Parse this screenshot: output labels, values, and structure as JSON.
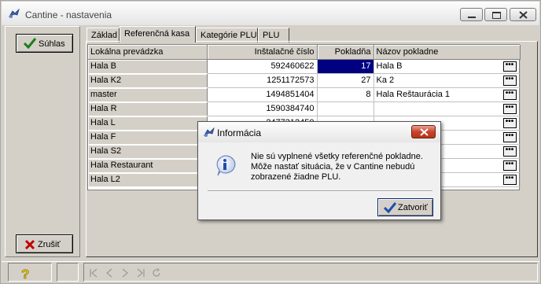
{
  "window": {
    "title": "Cantine - nastavenia"
  },
  "buttons": {
    "ok_label": "Súhlas",
    "cancel_label": "Zrušiť"
  },
  "tabs": [
    {
      "label": "Základ",
      "active": false
    },
    {
      "label": "Referenčná kasa",
      "active": true
    },
    {
      "label": "Kategórie PLU",
      "active": false
    },
    {
      "label": "PLU",
      "active": false
    }
  ],
  "grid": {
    "columns": [
      "Lokálna prevádzka",
      "Inštalačné číslo",
      "Pokladňa",
      "Názov pokladne"
    ],
    "rows": [
      {
        "name": "Hala B",
        "install_no": "592460622",
        "register": "17",
        "register_name": "Hala B"
      },
      {
        "name": "Hala K2",
        "install_no": "1251172573",
        "register": "27",
        "register_name": "Ka 2"
      },
      {
        "name": "master",
        "install_no": "1494851404",
        "register": "8",
        "register_name": "Hala Reštaurácia 1"
      },
      {
        "name": "Hala R",
        "install_no": "1590384740",
        "register": "",
        "register_name": ""
      },
      {
        "name": "Hala L",
        "install_no": "2477312450",
        "register": "",
        "register_name": ""
      },
      {
        "name": "Hala F",
        "install_no": "",
        "register": "",
        "register_name": ""
      },
      {
        "name": "Hala S2",
        "install_no": "",
        "register": "",
        "register_name": ""
      },
      {
        "name": "Hala Restaurant",
        "install_no": "",
        "register": "",
        "register_name": ""
      },
      {
        "name": "Hala L2",
        "install_no": "",
        "register": "",
        "register_name": ""
      }
    ],
    "ellipsis_label": "•••"
  },
  "statusbar": {
    "help_glyph": "?"
  },
  "dialog": {
    "title": "Informácia",
    "message": "Nie sú vyplnené všetky referenčné pokladne. Môže nastať situácia, že v Cantine nebudú zobrazené žiadne PLU.",
    "close_label": "Zatvoriť"
  },
  "colors": {
    "selection": "#000080",
    "face": "#d4d0c8",
    "ok_check": "#1a7f1a",
    "cancel_x": "#c00000",
    "info": "#1e4fb0"
  }
}
